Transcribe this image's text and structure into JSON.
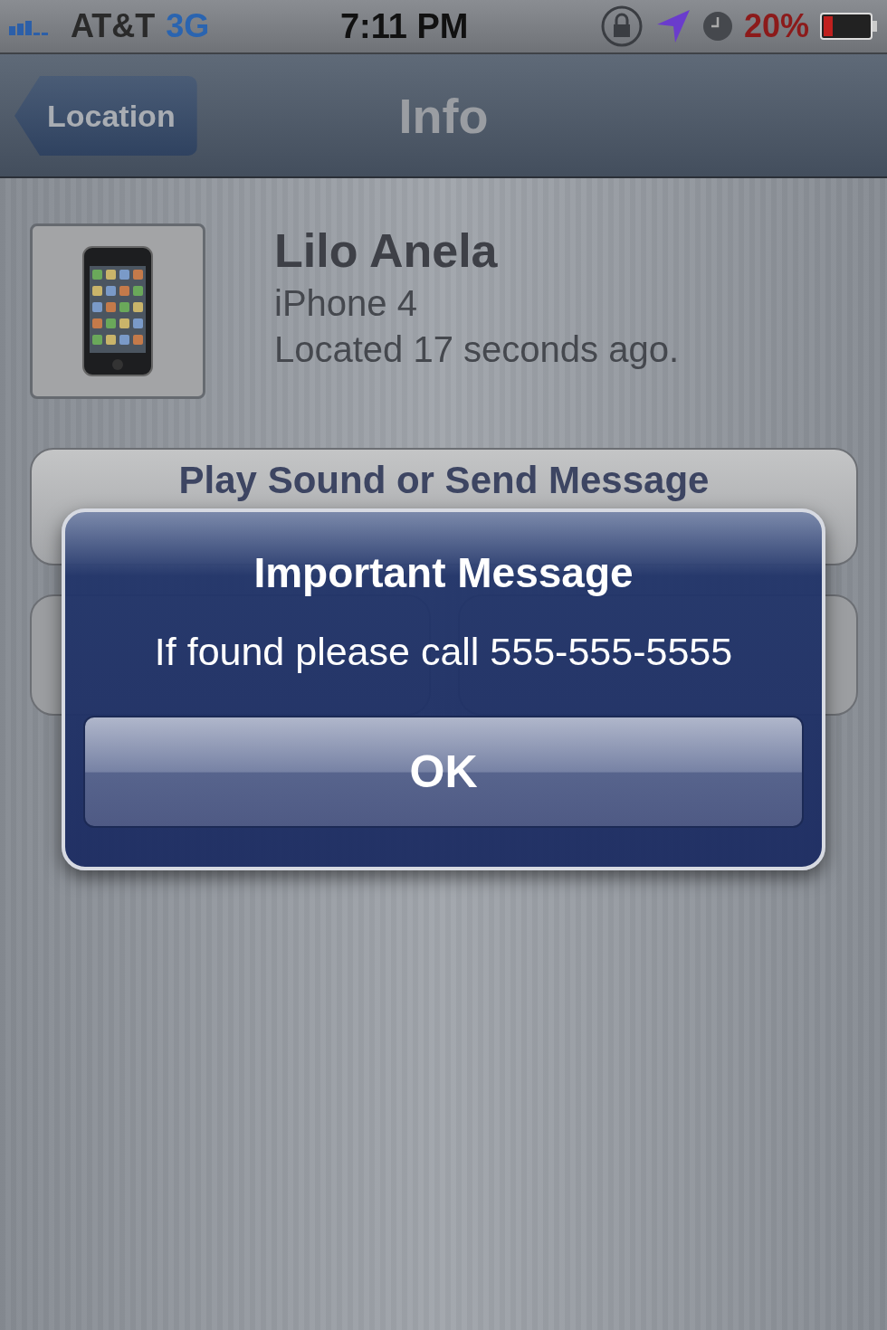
{
  "status_bar": {
    "carrier": "AT&T",
    "network": "3G",
    "time": "7:11 PM",
    "battery": "20%"
  },
  "nav_bar": {
    "back": "Location",
    "title": "Info"
  },
  "device": {
    "name": "Lilo Anela",
    "model": "iPhone 4",
    "located": "Located 17 seconds ago."
  },
  "buttons": [
    {
      "label": "Play Sound or Send Message"
    }
  ],
  "alert": {
    "title": "Important Message",
    "message": "If found please call 555-555-5555",
    "button": "OK"
  }
}
